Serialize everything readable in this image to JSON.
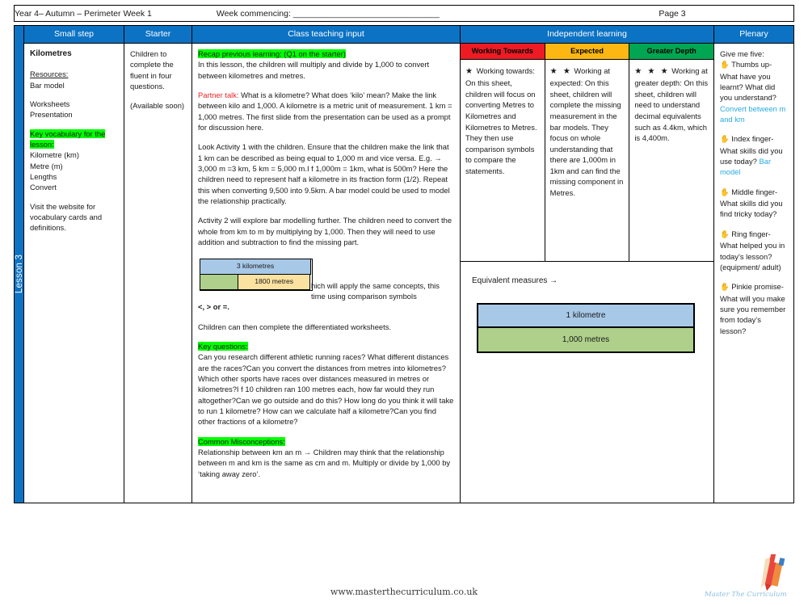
{
  "meta": {
    "title": "Year 4– Autumn – Perimeter Week 1",
    "week_commencing": "Week commencing: _______________________________",
    "page": "Page 3"
  },
  "lesson_spine": {
    "label": "Lesson 3",
    "color": "#0c72c4"
  },
  "columns": {
    "small_step": "Small step",
    "starter": "Starter",
    "class_teaching_input": "Class teaching input",
    "independent_learning": "Independent learning",
    "plenary": "Plenary"
  },
  "small_step": {
    "title": "Kilometres",
    "resources_heading": "Resources:",
    "resources": [
      "Bar model",
      "Worksheets",
      "Presentation"
    ],
    "vocab_heading": "Key vocabulary for the lesson:",
    "vocab": [
      "Kilometre (km)",
      "Metre (m)",
      "Lengths",
      "Convert"
    ],
    "note": "Visit the website for vocabulary cards and definitions."
  },
  "starter": {
    "text": "Children to complete the fluent in four questions.",
    "availability": "(Available soon)"
  },
  "teaching": {
    "recap_heading": "Recap previous learning: (Q1 on the starter)",
    "recap_body": "In this lesson, the children will multiply and divide by 1,000 to convert between kilometres and metres.",
    "partner_talk_label": "Partner talk:",
    "partner_talk_body": " What is a kilometre? What does ‘kilo’ mean? Make the link between kilo and 1,000. A kilometre is a metric unit of measurement. 1 km = 1,000 metres. The first slide from the presentation can be used as a prompt for discussion here.",
    "activity1": "Look Activity 1 with the children. Ensure that the children make the link that 1 km can be described as being equal to 1,000 m and vice versa. E.g. → 3,000 m =3 km, 5 km = 5,000 m.I f 1,000m = 1km, what is 500m? Here the children need to represent half a kilometre in its fraction form (1/2). Repeat this when converting 9,500 into 9.5km. A bar model could be used to model the relationship practically.",
    "activity2": "Activity 2 will explore bar modelling further. The children need to convert the whole from km to m  by multiplying by 1,000. Then they will need to use addition and  subtraction to find the missing part.",
    "bar_model_small": {
      "whole_label": "3 kilometres",
      "part_left_label": "",
      "part_right_label": "1800 metres",
      "whole_color": "#a8c8e8",
      "part_left_color": "#aed08a",
      "part_right_color": "#fbe2a0"
    },
    "after_bar_text": "hich will apply the same concepts, this time using comparison symbols ",
    "after_bar_symbols": "<, > or =.",
    "worksheets_line": "Children can then complete the differentiated worksheets.",
    "key_questions_heading": "Key questions:",
    "key_questions_body": "Can you research different athletic running races? What different distances are the races?Can you convert the distances from metres into kilometres? Which other sports have races over distances measured in metres or kilometres?I f 10 children ran 100 metres each, how far would they run altogether?Can we go outside and do this? How long do you think it will take to run 1 kilometre? How can we calculate half a kilometre?Can you find other fractions of a kilometre?",
    "misconceptions_heading": "Common Misconceptions:",
    "misconceptions_body": "Relationship between km an m → Children may think that the relationship between m and km is the same as cm and m. Multiply or divide by 1,000 by ‘taking away zero’."
  },
  "independent": {
    "bands": [
      {
        "label": "Working Towards",
        "color": "#ee1b24",
        "stars": "★",
        "text": "Working towards:\nOn this sheet, children will focus on converting Metres to Kilometres and Kilometres to Metres. They then use comparison symbols to compare the statements."
      },
      {
        "label": "Expected",
        "color": "#fcb713",
        "stars": "★ ★",
        "text": "Working at expected:\nOn this sheet, children will complete the missing measurement in the bar models. They focus on whole understanding that there are 1,000m in 1km and can find the missing component in Metres."
      },
      {
        "label": "Greater Depth",
        "color": "#00a651",
        "stars": "★ ★ ★",
        "text": "Working at greater depth:\nOn this sheet, children will need to understand decimal equivalents such as 4.4km, which is 4,400m."
      }
    ],
    "equivalent_label": "Equivalent measures →",
    "bar_model_large": {
      "top_label": "1 kilometre",
      "bottom_label": "1,000 metres",
      "top_color": "#a8c8e8",
      "bottom_color": "#aed08a"
    }
  },
  "plenary": {
    "intro": "Give me five:",
    "items": [
      {
        "icon": "hand-icon",
        "text": " Thumbs up- What have you learnt? What did you understand?",
        "highlight": "Convert between m and km"
      },
      {
        "icon": "hand-icon",
        "text": " Index finger- What skills did you use today?",
        "highlight": "Bar model"
      },
      {
        "icon": "hand-icon",
        "text": " Middle finger- What skills did you find tricky today?",
        "highlight": ""
      },
      {
        "icon": "hand-icon",
        "text": " Ring finger- What helped you in today’s lesson? (equipment/ adult)",
        "highlight": ""
      },
      {
        "icon": "hand-icon",
        "text": " Pinkie promise- What will you make sure you remember from today’s lesson?",
        "highlight": ""
      }
    ],
    "highlight_color": "#2aaae2"
  },
  "footer": {
    "url": "www.masterthecurriculum.co.uk"
  },
  "logo": {
    "wordmark": "Master The Curriculum",
    "icon": "pencil-icon"
  }
}
